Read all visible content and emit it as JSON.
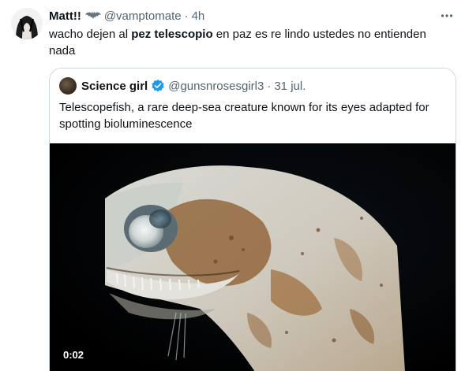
{
  "tweet": {
    "author_name": "Matt!!",
    "author_handle": "@vamptomate",
    "separator": "·",
    "time": "4h",
    "text_before": "wacho dejen al ",
    "text_bold": "pez telescopio",
    "text_after": " en paz es re lindo ustedes no entienden nada",
    "more_icon": "more-horizontal-icon",
    "badge_icon": "bat-emoji-icon"
  },
  "quote": {
    "author_name": "Science girl",
    "author_handle": "@gunsnrosesgirl3",
    "separator": "·",
    "date": "31 jul.",
    "verified_icon": "verified-badge-icon",
    "verified_color": "#1d9bf0",
    "text": "Telescopefish, a rare deep-sea creature known for its eyes adapted for spotting bioluminescence",
    "video": {
      "timestamp": "0:02"
    }
  }
}
